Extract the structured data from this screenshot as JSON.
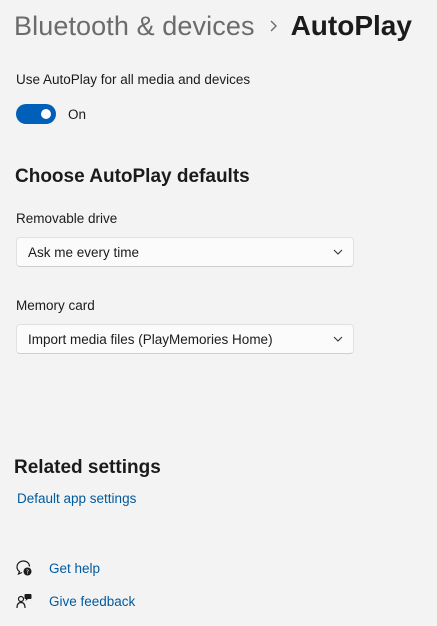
{
  "breadcrumb": {
    "parent": "Bluetooth & devices",
    "current": "AutoPlay"
  },
  "autoplay_toggle": {
    "label": "Use AutoPlay for all media and devices",
    "state_text": "On",
    "on": true
  },
  "defaults": {
    "title": "Choose AutoPlay defaults",
    "removable_drive": {
      "label": "Removable drive",
      "value": "Ask me every time"
    },
    "memory_card": {
      "label": "Memory card",
      "value": "Import media files (PlayMemories Home)"
    }
  },
  "related": {
    "title": "Related settings",
    "default_apps_link": "Default app settings"
  },
  "help": {
    "get_help": "Get help",
    "give_feedback": "Give feedback"
  },
  "colors": {
    "accent": "#005fb8",
    "link": "#005a9e",
    "background": "#f3f3f3"
  }
}
